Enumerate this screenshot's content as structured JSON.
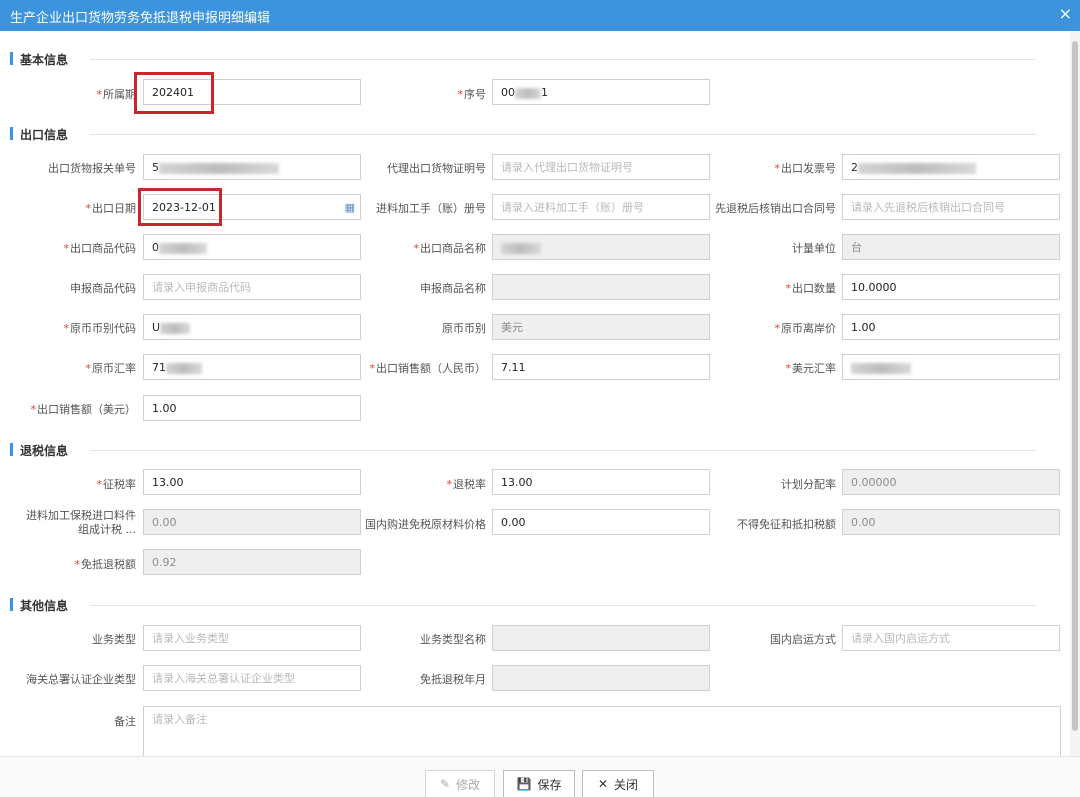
{
  "window": {
    "title": "生产企业出口货物劳务免抵退税申报明细编辑",
    "close_glyph": "×"
  },
  "sections": {
    "basic": "基本信息",
    "export": "出口信息",
    "refund": "退税信息",
    "other": "其他信息"
  },
  "basic": {
    "period_label": "所属期",
    "period_value": "202401",
    "seq_label": "序号",
    "seq_prefix": "00",
    "seq_suffix": "1"
  },
  "export": {
    "customs_no_label": "出口货物报关单号",
    "customs_no_prefix": "5",
    "agent_cert_label": "代理出口货物证明号",
    "agent_cert_ph": "请录入代理出口货物证明号",
    "invoice_no_label": "出口发票号",
    "invoice_no_prefix": "2",
    "export_date_label": "出口日期",
    "export_date_value": "2023-12-01",
    "processing_book_label": "进料加工手（账）册号",
    "processing_book_ph": "请录入进料加工手（账）册号",
    "contract_no_label": "先退税后核销出口合同号",
    "contract_no_ph": "请录入先退税后核销出口合同号",
    "goods_code_label": "出口商品代码",
    "goods_code_prefix": "0",
    "goods_name_label": "出口商品名称",
    "unit_label": "计量单位",
    "unit_value": "台",
    "decl_code_label": "申报商品代码",
    "decl_code_ph": "请录入申报商品代码",
    "decl_name_label": "申报商品名称",
    "qty_label": "出口数量",
    "qty_value": "10.0000",
    "currency_code_label": "原币币别代码",
    "currency_code_prefix": "U",
    "currency_label": "原币币别",
    "currency_value": "美元",
    "unit_price_label": "原币离岸价",
    "unit_price_value": "1.00",
    "rate_label": "原币汇率",
    "rate_prefix": "71",
    "sales_rmb_label": "出口销售额（人民币）",
    "sales_rmb_value": "7.11",
    "usd_rate_label": "美元汇率",
    "sales_usd_label": "出口销售额（美元）",
    "sales_usd_value": "1.00"
  },
  "refund": {
    "levy_rate_label": "征税率",
    "levy_rate_value": "13.00",
    "refund_rate_label": "退税率",
    "refund_rate_value": "13.00",
    "plan_ratio_label": "计划分配率",
    "plan_ratio_value": "0.00000",
    "bonded_tax_label": "进料加工保税进口料件组成计税 ...",
    "bonded_tax_value": "0.00",
    "domestic_price_label": "国内购进免税原材料价格",
    "domestic_price_value": "0.00",
    "nondeduct_label": "不得免征和抵扣税额",
    "nondeduct_value": "0.00",
    "exempt_amount_label": "免抵退税额",
    "exempt_amount_value": "0.92"
  },
  "other": {
    "biz_type_label": "业务类型",
    "biz_type_ph": "请录入业务类型",
    "biz_type_name_label": "业务类型名称",
    "transport_label": "国内启运方式",
    "transport_ph": "请录入国内启运方式",
    "customs_cert_label": "海关总署认证企业类型",
    "customs_cert_ph": "请录入海关总署认证企业类型",
    "exempt_period_label": "免抵退税年月",
    "remark_label": "备注",
    "remark_ph": "请录入备注"
  },
  "footer": {
    "modify": "修改",
    "save": "保存",
    "close": "关闭"
  },
  "colors": {
    "titlebar": "#3c93de",
    "required": "#e53935",
    "highlight": "#c8282d"
  }
}
